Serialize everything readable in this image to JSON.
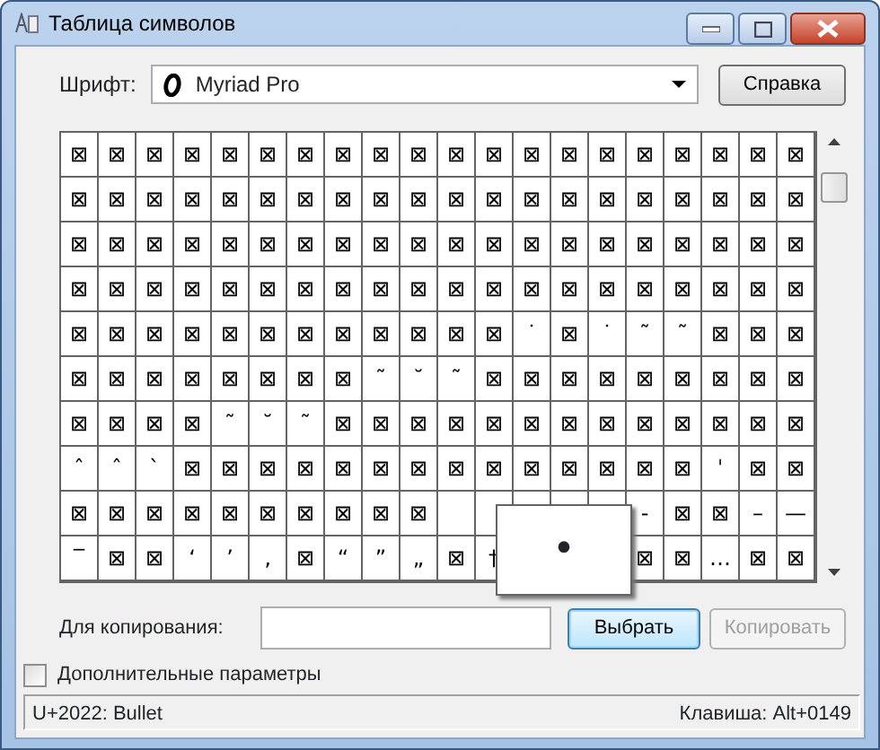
{
  "window": {
    "title": "Таблица символов"
  },
  "font": {
    "label": "Шрифт:",
    "value": "Myriad Pro",
    "help_button": "Справка"
  },
  "grid": {
    "rows": [
      [
        "⊠",
        "⊠",
        "⊠",
        "⊠",
        "⊠",
        "⊠",
        "⊠",
        "⊠",
        "⊠",
        "⊠",
        "⊠",
        "⊠",
        "⊠",
        "⊠",
        "⊠",
        "⊠",
        "⊠",
        "⊠",
        "⊠",
        "⊠"
      ],
      [
        "⊠",
        "⊠",
        "⊠",
        "⊠",
        "⊠",
        "⊠",
        "⊠",
        "⊠",
        "⊠",
        "⊠",
        "⊠",
        "⊠",
        "⊠",
        "⊠",
        "⊠",
        "⊠",
        "⊠",
        "⊠",
        "⊠",
        "⊠"
      ],
      [
        "⊠",
        "⊠",
        "⊠",
        "⊠",
        "⊠",
        "⊠",
        "⊠",
        "⊠",
        "⊠",
        "⊠",
        "⊠",
        "⊠",
        "⊠",
        "⊠",
        "⊠",
        "⊠",
        "⊠",
        "⊠",
        "⊠",
        "⊠"
      ],
      [
        "⊠",
        "⊠",
        "⊠",
        "⊠",
        "⊠",
        "⊠",
        "⊠",
        "⊠",
        "⊠",
        "⊠",
        "⊠",
        "⊠",
        "⊠",
        "⊠",
        "⊠",
        "⊠",
        "⊠",
        "⊠",
        "⊠",
        "⊠"
      ],
      [
        "⊠",
        "⊠",
        "⊠",
        "⊠",
        "⊠",
        "⊠",
        "⊠",
        "⊠",
        "⊠",
        "⊠",
        "⊠",
        "⊠",
        "˙",
        "⊠",
        "˙",
        "˜",
        "˜",
        "⊠",
        "⊠",
        "⊠"
      ],
      [
        "⊠",
        "⊠",
        "⊠",
        "⊠",
        "⊠",
        "⊠",
        "⊠",
        "⊠",
        "˜",
        "˘",
        "˜",
        "⊠",
        "⊠",
        "⊠",
        "⊠",
        "⊠",
        "⊠",
        "⊠",
        "⊠",
        "⊠"
      ],
      [
        "⊠",
        "⊠",
        "⊠",
        "⊠",
        "˜",
        "˘",
        "˜",
        "⊠",
        "⊠",
        "⊠",
        "⊠",
        "⊠",
        "⊠",
        "⊠",
        "⊠",
        "⊠",
        "⊠",
        "⊠",
        "⊠",
        "⊠"
      ],
      [
        "ˆ",
        "ˆ",
        "ˋ",
        "⊠",
        "⊠",
        "⊠",
        "⊠",
        "⊠",
        "⊠",
        "⊠",
        "⊠",
        "⊠",
        "⊠",
        "⊠",
        "⊠",
        "⊠",
        "⊠",
        "ˈ",
        "⊠",
        "⊠"
      ],
      [
        "⊠",
        "⊠",
        "⊠",
        "⊠",
        "⊠",
        "⊠",
        "⊠",
        "⊠",
        "⊠",
        "⊠",
        null,
        null,
        null,
        null,
        null,
        "‐",
        "⊠",
        "⊠",
        "–",
        "—"
      ],
      [
        "‾",
        "⊠",
        "⊠",
        "‘",
        "’",
        "‚",
        "⊠",
        "“",
        "”",
        "„",
        "⊠",
        "†",
        null,
        null,
        null,
        "⊠",
        "⊠",
        "…",
        "⊠",
        "⊠"
      ]
    ],
    "magnified": "•"
  },
  "copy": {
    "label": "Для копирования:",
    "select_button": "Выбрать",
    "copy_button": "Копировать",
    "copy_disabled": true
  },
  "advanced": {
    "label": "Дополнительные параметры",
    "checked": false
  },
  "status_bar": {
    "left": "U+2022: Bullet",
    "right": "Клавиша: Alt+0149"
  }
}
